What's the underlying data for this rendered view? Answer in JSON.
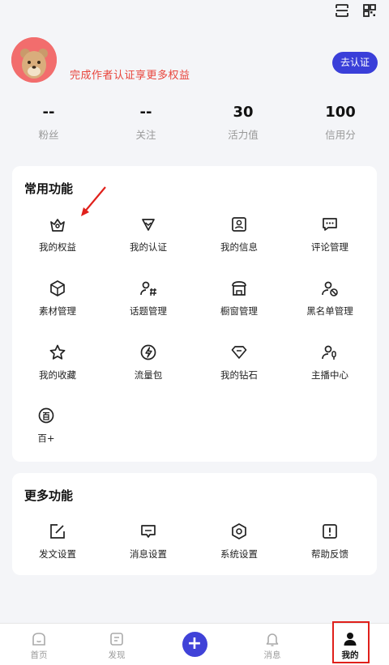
{
  "header": {
    "icons": [
      "scan-icon",
      "qrcode-icon"
    ]
  },
  "profile": {
    "promo_text": "完成作者认证享更多权益",
    "verify_button": "去认证"
  },
  "stats": [
    {
      "value": "--",
      "label": "粉丝"
    },
    {
      "value": "--",
      "label": "关注"
    },
    {
      "value": "30",
      "label": "活力值"
    },
    {
      "value": "100",
      "label": "信用分"
    }
  ],
  "common": {
    "title": "常用功能",
    "items": [
      {
        "label": "我的权益",
        "icon": "crown-icon"
      },
      {
        "label": "我的认证",
        "icon": "verify-heart-icon"
      },
      {
        "label": "我的信息",
        "icon": "profile-card-icon"
      },
      {
        "label": "评论管理",
        "icon": "comment-icon"
      },
      {
        "label": "素材管理",
        "icon": "cube-icon"
      },
      {
        "label": "话题管理",
        "icon": "topic-user-icon"
      },
      {
        "label": "橱窗管理",
        "icon": "shop-icon"
      },
      {
        "label": "黑名单管理",
        "icon": "block-user-icon"
      },
      {
        "label": "我的收藏",
        "icon": "star-icon"
      },
      {
        "label": "流量包",
        "icon": "bolt-icon"
      },
      {
        "label": "我的钻石",
        "icon": "diamond-icon"
      },
      {
        "label": "主播中心",
        "icon": "mic-user-icon"
      },
      {
        "label": "百+",
        "icon": "bai-icon"
      }
    ]
  },
  "more": {
    "title": "更多功能",
    "items": [
      {
        "label": "发文设置",
        "icon": "edit-icon"
      },
      {
        "label": "消息设置",
        "icon": "message-icon"
      },
      {
        "label": "系统设置",
        "icon": "settings-icon"
      },
      {
        "label": "帮助反馈",
        "icon": "help-icon"
      }
    ]
  },
  "tabs": [
    {
      "label": "首页",
      "icon": "home-icon"
    },
    {
      "label": "发现",
      "icon": "discover-icon"
    },
    {
      "label": "",
      "icon": "plus-icon"
    },
    {
      "label": "消息",
      "icon": "bell-icon"
    },
    {
      "label": "我的",
      "icon": "person-icon",
      "active": true
    }
  ],
  "colors": {
    "accent": "#3a3fd9",
    "promo": "#e8453c",
    "highlight": "#e0201b"
  }
}
